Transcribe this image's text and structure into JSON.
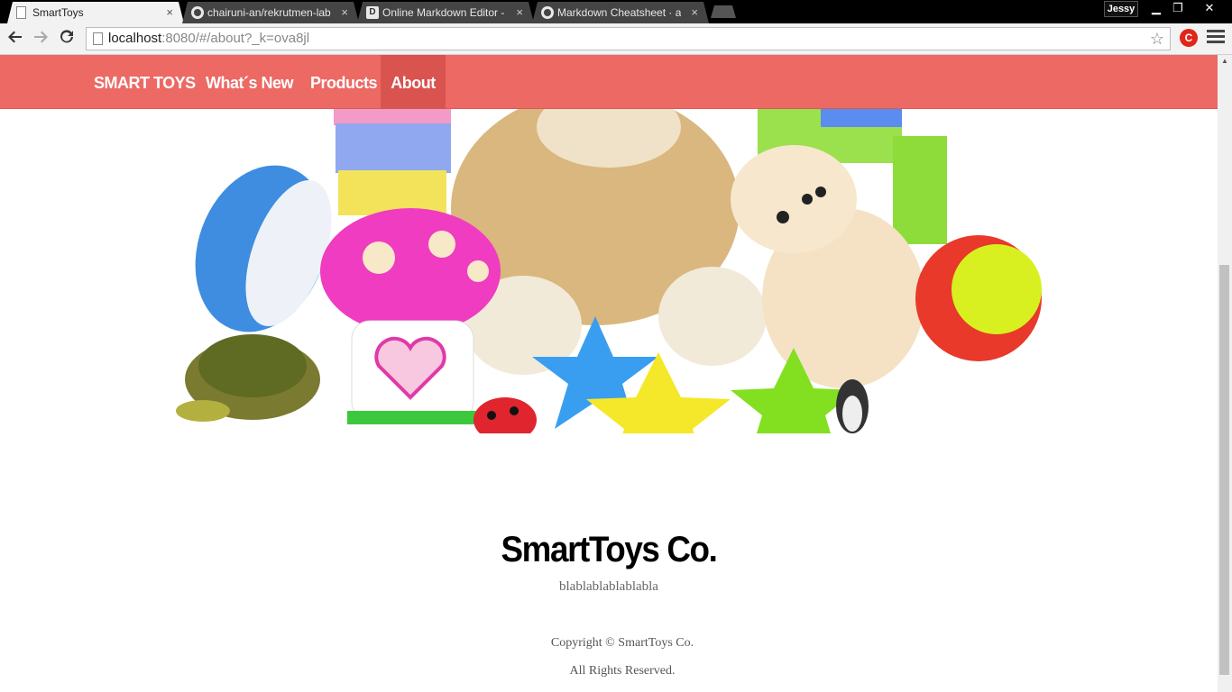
{
  "browser": {
    "tabs": [
      {
        "title": "SmartToys",
        "icon": "page-icon",
        "active": true
      },
      {
        "title": "chairuni-an/rekrutmen-lab",
        "icon": "github-icon",
        "active": false
      },
      {
        "title": "Online Markdown Editor - ",
        "icon": "dillinger-icon",
        "active": false
      },
      {
        "title": "Markdown Cheatsheet · a",
        "icon": "github-icon",
        "active": false
      }
    ],
    "tab_close": "×",
    "user": "Jessy",
    "window_controls": {
      "minimize": "▁",
      "maximize": "❐",
      "close": "✕"
    },
    "url_host": "localhost",
    "url_rest": ":8080/#/about?_k=ova8jl",
    "extension_label": "C"
  },
  "site": {
    "colors": {
      "nav_bg": "#ec6964",
      "nav_active": "#d9534f"
    },
    "nav": {
      "brand": "SMART TOYS",
      "items": [
        "What´s New",
        "Products",
        "About"
      ],
      "active": "About"
    },
    "about": {
      "title": "SmartToys Co.",
      "tagline": "blablablablablabla"
    },
    "footer": {
      "copyright": "Copyright © SmartToys Co.",
      "rights": "All Rights Reserved."
    }
  }
}
